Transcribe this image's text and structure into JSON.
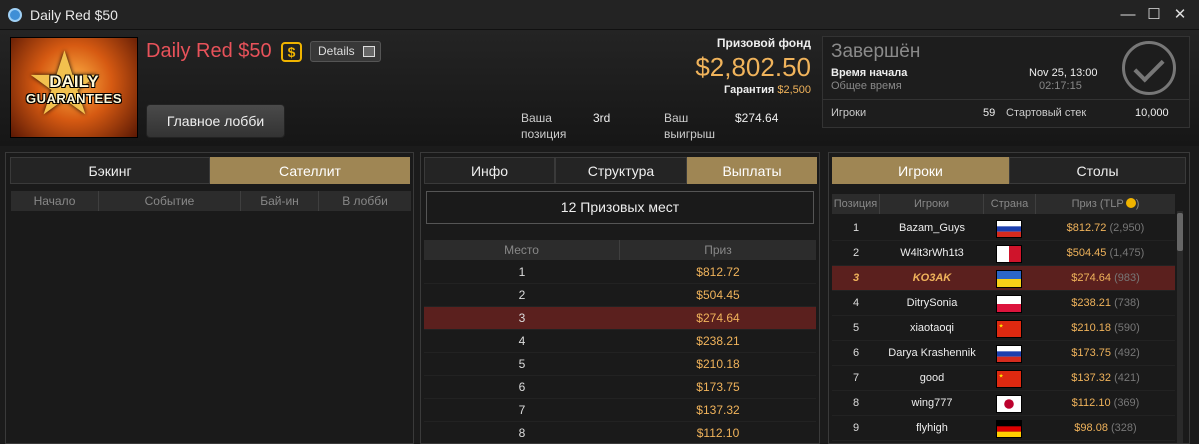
{
  "window": {
    "title": "Daily Red $50",
    "minimize": "—",
    "maximize": "☐",
    "close": "✕"
  },
  "banner": {
    "line1": "DAILY",
    "line2": "GUARANTEES"
  },
  "tournament": {
    "name": "Daily Red $50",
    "currency_badge": "$",
    "details_label": "Details",
    "lobby_button": "Главное лобби",
    "prize_fund_label": "Призовой фонд",
    "prize_fund": "$2,802.50",
    "guarantee_label": "Гарантия",
    "guarantee": "$2,500",
    "your_position_label": [
      "Ваша",
      "позиция"
    ],
    "your_position": "3rd",
    "your_win_label": [
      "Ваш",
      "выигрыш"
    ],
    "your_win": "$274.64"
  },
  "status": {
    "state": "Завершён",
    "start_label": "Время начала",
    "start_value": "Nov 25, 13:00",
    "total_label": "Общее время",
    "total_value": "02:17:15",
    "players_label": "Игроки",
    "players_value": "59",
    "stack_label": "Стартовый стек",
    "stack_value": "10,000"
  },
  "left_panel": {
    "tabs": [
      {
        "label": "Бэкинг",
        "active": false
      },
      {
        "label": "Сателлит",
        "active": true
      }
    ],
    "columns": [
      "Начало",
      "Событие",
      "Бай-ин",
      "В лобби"
    ]
  },
  "middle_panel": {
    "tabs": [
      {
        "label": "Инфо",
        "active": false
      },
      {
        "label": "Структура",
        "active": false
      },
      {
        "label": "Выплаты",
        "active": true
      }
    ],
    "places_count": "12 Призовых мест",
    "columns": [
      "Место",
      "Приз"
    ],
    "rows": [
      {
        "place": "1",
        "prize": "$812.72"
      },
      {
        "place": "2",
        "prize": "$504.45"
      },
      {
        "place": "3",
        "prize": "$274.64",
        "highlight": true
      },
      {
        "place": "4",
        "prize": "$238.21"
      },
      {
        "place": "5",
        "prize": "$210.18"
      },
      {
        "place": "6",
        "prize": "$173.75"
      },
      {
        "place": "7",
        "prize": "$137.32"
      },
      {
        "place": "8",
        "prize": "$112.10"
      }
    ]
  },
  "right_panel": {
    "tabs": [
      {
        "label": "Игроки",
        "active": true
      },
      {
        "label": "Столы",
        "active": false
      }
    ],
    "columns": [
      "Позиция",
      "Игроки",
      "Страна",
      "Приз (TLP"
    ],
    "rows": [
      {
        "pos": "1",
        "name": "Bazam_Guys",
        "flag": "russia",
        "prize": "$812.72",
        "tlp": "(2,950)"
      },
      {
        "pos": "2",
        "name": "W4lt3rWh1t3",
        "flag": "malta",
        "prize": "$504.45",
        "tlp": "(1,475)"
      },
      {
        "pos": "3",
        "name": "KO3AK",
        "flag": "ukraine",
        "prize": "$274.64",
        "tlp": "(983)",
        "highlight": true
      },
      {
        "pos": "4",
        "name": "DitrySonia",
        "flag": "poland",
        "prize": "$238.21",
        "tlp": "(738)"
      },
      {
        "pos": "5",
        "name": "xiaotaoqi",
        "flag": "china",
        "prize": "$210.18",
        "tlp": "(590)"
      },
      {
        "pos": "6",
        "name": "Darya Krashennik",
        "flag": "russia",
        "prize": "$173.75",
        "tlp": "(492)"
      },
      {
        "pos": "7",
        "name": "good",
        "flag": "china",
        "prize": "$137.32",
        "tlp": "(421)"
      },
      {
        "pos": "8",
        "name": "wing777",
        "flag": "japan",
        "prize": "$112.10",
        "tlp": "(369)"
      },
      {
        "pos": "9",
        "name": "flyhigh",
        "flag": "germany",
        "prize": "$98.08",
        "tlp": "(328)"
      }
    ]
  }
}
